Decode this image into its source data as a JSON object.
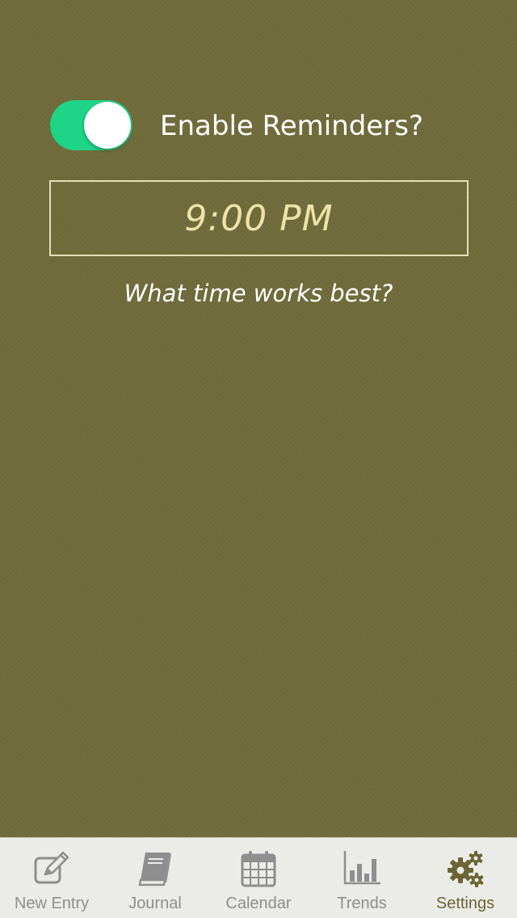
{
  "reminders": {
    "enable_label": "Enable Reminders?",
    "enabled": true,
    "time_value": "9:00 PM",
    "time_hint": "What time works best?"
  },
  "tabbar": {
    "items": [
      {
        "label": "New Entry",
        "icon": "pencil-square-icon",
        "active": false
      },
      {
        "label": "Journal",
        "icon": "book-icon",
        "active": false
      },
      {
        "label": "Calendar",
        "icon": "calendar-icon",
        "active": false
      },
      {
        "label": "Trends",
        "icon": "bar-chart-icon",
        "active": false
      },
      {
        "label": "Settings",
        "icon": "gears-icon",
        "active": true
      }
    ]
  },
  "colors": {
    "background": "#6f6b3b",
    "toggle_on": "#1dd487",
    "time_text": "#ece4a6",
    "tab_inactive": "#8e8e8e",
    "tab_active": "#6b6534"
  }
}
